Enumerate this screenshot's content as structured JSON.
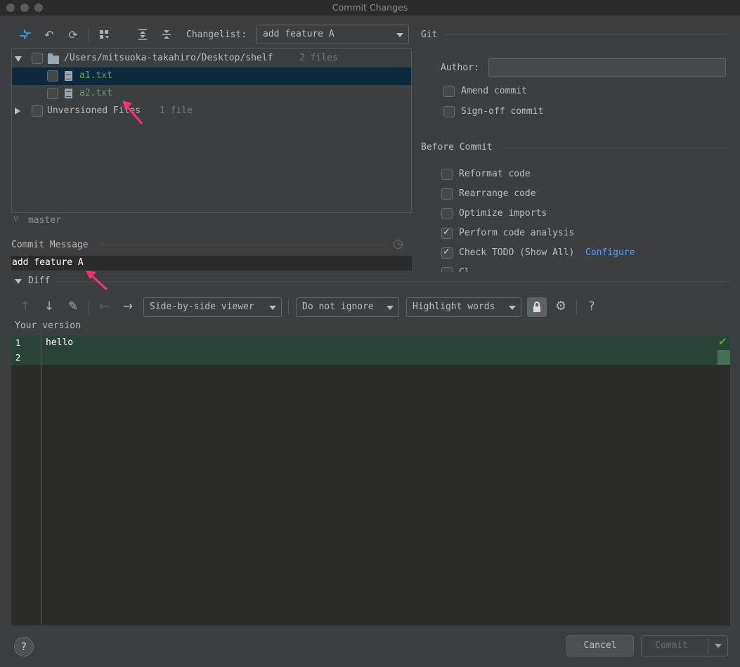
{
  "window": {
    "title": "Commit Changes"
  },
  "toolbar": {
    "icons": [
      "show-diff-icon",
      "rollback-icon",
      "refresh-icon",
      "group-by-icon",
      "expand-all-icon",
      "collapse-all-icon"
    ],
    "changelist_label": "Changelist:",
    "changelist_value": "add feature A"
  },
  "tree": {
    "root": {
      "path": "/Users/mitsuoka-takahiro/Desktop/shelf",
      "count": "2 files"
    },
    "files": [
      {
        "name": "a1.txt",
        "selected": true
      },
      {
        "name": "a2.txt",
        "selected": false
      }
    ],
    "unversioned": {
      "label": "Unversioned Files",
      "count": "1 file"
    }
  },
  "branch": {
    "name": "master"
  },
  "commit_message": {
    "label": "Commit Message",
    "value": "add feature A"
  },
  "git": {
    "title": "Git",
    "author_label": "Author:",
    "author_value": "",
    "options": [
      {
        "label": "Amend commit",
        "checked": false
      },
      {
        "label": "Sign-off commit",
        "checked": false
      }
    ]
  },
  "before_commit": {
    "title": "Before Commit",
    "options": [
      {
        "label": "Reformat code",
        "checked": false
      },
      {
        "label": "Rearrange code",
        "checked": false
      },
      {
        "label": "Optimize imports",
        "checked": false
      },
      {
        "label": "Perform code analysis",
        "checked": true
      },
      {
        "label": "Check TODO (Show All)",
        "checked": true,
        "link": "Configure"
      },
      {
        "label": "Cl",
        "checked": false
      }
    ]
  },
  "diff": {
    "title": "Diff",
    "viewer": "Side-by-side viewer",
    "ignore": "Do not ignore",
    "highlight": "Highlight words",
    "help": "?",
    "version_label": "Your version",
    "lines": [
      {
        "no": "1",
        "text": "hello"
      },
      {
        "no": "2",
        "text": ""
      }
    ]
  },
  "footer": {
    "help": "?",
    "cancel": "Cancel",
    "commit": "Commit"
  },
  "colors": {
    "accent": "#589df6",
    "annotation_arrow": "#ff2d72",
    "added_line": "#294436",
    "selection": "#0d293e"
  }
}
